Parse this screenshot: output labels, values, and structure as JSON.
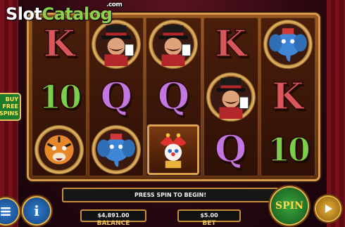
{
  "logo": {
    "part1": "Slot",
    "part2": "Catalog",
    "suffix": ".com"
  },
  "side_button": {
    "label": "BUY FREE SPINS"
  },
  "reels": [
    [
      "K",
      "10",
      "tiger"
    ],
    [
      "ringmaster",
      "Q",
      "elephant"
    ],
    [
      "ringmaster",
      "Q",
      "jester"
    ],
    [
      "K",
      "ringmaster",
      "Q"
    ],
    [
      "elephant",
      "K",
      "10"
    ]
  ],
  "message": "PRESS SPIN TO BEGIN!",
  "balance": {
    "value": "$4,891.00",
    "label": "BALANCE"
  },
  "bet": {
    "value": "$5.00",
    "label": "BET"
  },
  "buttons": {
    "spin": "SPIN",
    "info": "i"
  },
  "icons": {
    "menu": "menu-icon",
    "play": "play-icon"
  },
  "colors": {
    "frame": "#9a5a24",
    "spin": "#3aa53f",
    "gold": "#e6b94d",
    "bg": "#2b0710"
  }
}
